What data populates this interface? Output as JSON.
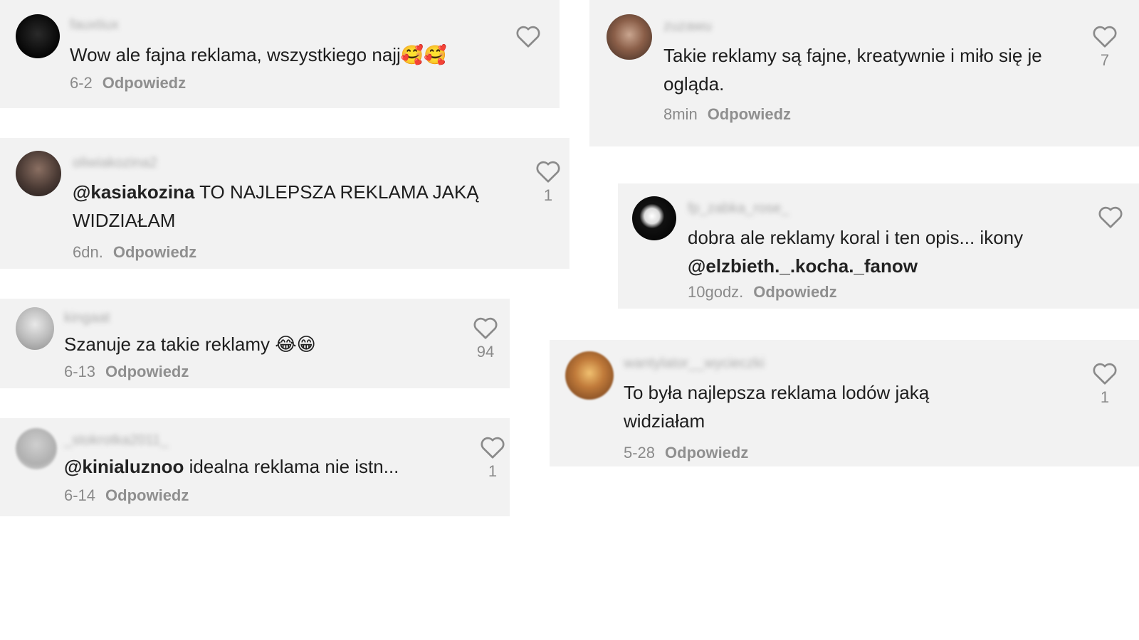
{
  "comments": [
    {
      "username": "fauxtiux",
      "mention": "",
      "text": "Wow ale fajna reklama, wszystkiego najj",
      "emoji": "🥰🥰",
      "time": "6-2",
      "reply": "Odpowiedz",
      "likes": ""
    },
    {
      "username": "oliwiakozina2",
      "mention": "@kasiakozina",
      "text": " TO NAJLEPSZA REKLAMA JAKĄ WIDZIAŁAM",
      "emoji": "",
      "time": "6dn.",
      "reply": "Odpowiedz",
      "likes": "1"
    },
    {
      "username": "kingaat",
      "mention": "",
      "text": "Szanuje za takie reklamy ",
      "emoji": "😂😁",
      "time": "6-13",
      "reply": "Odpowiedz",
      "likes": "94"
    },
    {
      "username": "_stokrotka2011_",
      "mention": "@kinialuznoo",
      "text": " idealna reklama nie istn...",
      "emoji": "",
      "time": "6-14",
      "reply": "Odpowiedz",
      "likes": "1"
    },
    {
      "username": "zuzawu",
      "mention": "",
      "text": "Takie reklamy są fajne, kreatywnie i miło się je ogląda.",
      "emoji": "",
      "time": "8min",
      "reply": "Odpowiedz",
      "likes": "7"
    },
    {
      "username": "fp_zabka_rose_",
      "mention": "",
      "text": "dobra ale reklamy koral i ten opis... ikony ",
      "mention2": "@elzbieth._.kocha._fanow",
      "emoji": "",
      "time": "10godz.",
      "reply": "Odpowiedz",
      "likes": ""
    },
    {
      "username": "wantylator__wycieczki",
      "mention": "",
      "text": "To była najlepsza reklama lodów jaką widziałam",
      "emoji": "",
      "time": "5-28",
      "reply": "Odpowiedz",
      "likes": "1"
    }
  ],
  "colors": {
    "card_bg": "#f2f2f2",
    "meta": "#8a8a8a",
    "text": "#1e1e1e"
  },
  "icons": {
    "like": "heart-outline-icon"
  }
}
